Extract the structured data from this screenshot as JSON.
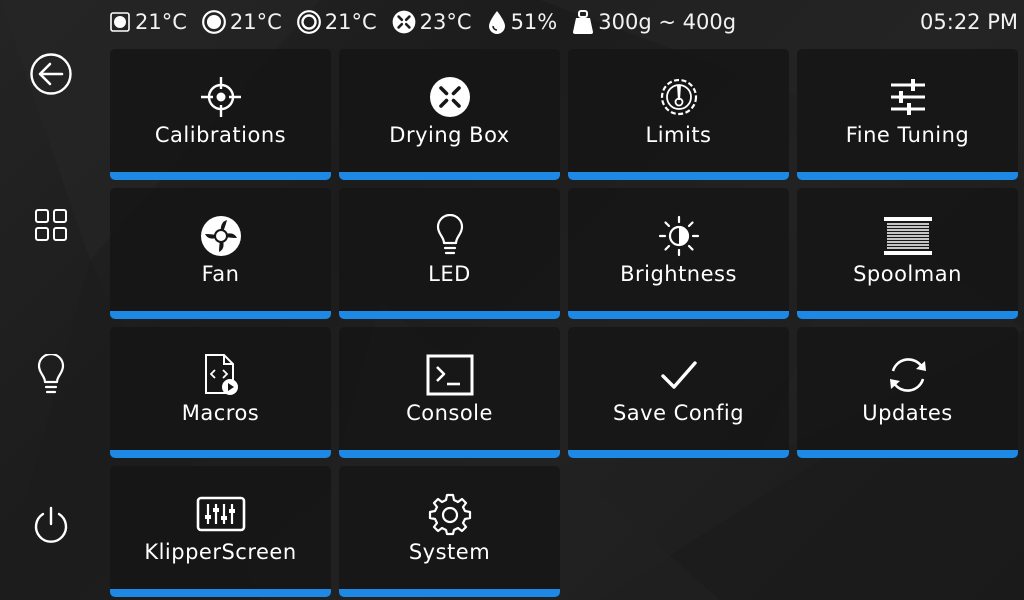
{
  "status": {
    "extruder_temp": "21°C",
    "bed_temp": "21°C",
    "chamber_temp": "21°C",
    "drying_box_temp": "23°C",
    "humidity": "51%",
    "filament_weight": "300g ~ 400g",
    "time": "05:22 PM"
  },
  "sidebar": {
    "items": [
      {
        "icon": "back-arrow-icon"
      },
      {
        "icon": "grid-icon"
      },
      {
        "icon": "lightbulb-icon"
      },
      {
        "icon": "power-icon"
      }
    ]
  },
  "menu": {
    "items": [
      {
        "label": "Calibrations",
        "icon": "crosshair-icon"
      },
      {
        "label": "Drying Box",
        "icon": "drying-box-icon"
      },
      {
        "label": "Limits",
        "icon": "speed-gauge-icon"
      },
      {
        "label": "Fine Tuning",
        "icon": "sliders-icon"
      },
      {
        "label": "Fan",
        "icon": "fan-icon"
      },
      {
        "label": "LED",
        "icon": "lightbulb-icon"
      },
      {
        "label": "Brightness",
        "icon": "brightness-icon"
      },
      {
        "label": "Spoolman",
        "icon": "spool-icon"
      },
      {
        "label": "Macros",
        "icon": "macro-file-icon"
      },
      {
        "label": "Console",
        "icon": "terminal-icon"
      },
      {
        "label": "Save Config",
        "icon": "checkmark-icon"
      },
      {
        "label": "Updates",
        "icon": "refresh-icon"
      },
      {
        "label": "KlipperScreen",
        "icon": "mixer-icon"
      },
      {
        "label": "System",
        "icon": "gear-icon"
      }
    ]
  },
  "colors": {
    "accent": "#1e88e5",
    "tile_background": "#161616",
    "text": "#ffffff"
  }
}
